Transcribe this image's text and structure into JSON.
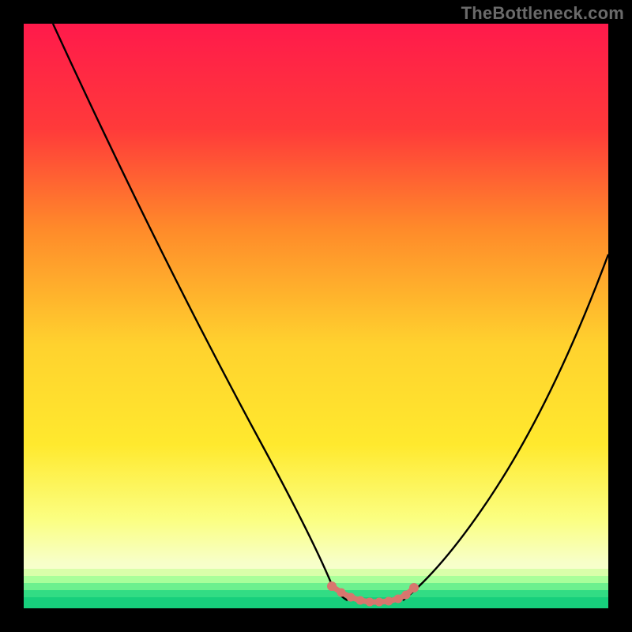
{
  "watermark": "TheBottleneck.com",
  "chart_data": {
    "type": "line",
    "title": "",
    "xlabel": "",
    "ylabel": "",
    "xlim": [
      0,
      100
    ],
    "ylim": [
      0,
      100
    ],
    "grid": false,
    "legend": false,
    "series": [
      {
        "name": "left-curve",
        "x": [
          5,
          10,
          15,
          20,
          25,
          30,
          35,
          40,
          45,
          48,
          50,
          52,
          54
        ],
        "values": [
          100,
          88,
          76,
          65,
          54,
          44,
          34,
          24,
          14,
          8,
          4,
          2,
          1
        ]
      },
      {
        "name": "right-curve",
        "x": [
          64,
          66,
          68,
          70,
          73,
          76,
          80,
          84,
          88,
          92,
          96,
          100
        ],
        "values": [
          1,
          2,
          4,
          6,
          10,
          15,
          22,
          30,
          38,
          46,
          54,
          61
        ]
      },
      {
        "name": "flat-bottom-marker",
        "x": [
          52,
          53,
          54,
          55,
          56,
          57,
          58,
          59,
          60,
          61,
          62,
          63,
          64,
          65,
          66
        ],
        "values": [
          1.5,
          1,
          0.8,
          0.7,
          0.6,
          0.6,
          0.6,
          0.6,
          0.6,
          0.6,
          0.7,
          0.8,
          1,
          1.2,
          1.5
        ]
      }
    ],
    "background_gradient": {
      "top": "#ff1a4b",
      "mid1": "#ff8a2a",
      "mid2": "#ffe92e",
      "mid3": "#f7ffb7",
      "bottom_stripes": [
        "#d9ffaa",
        "#a8ff9a",
        "#6cf08e",
        "#32dc84",
        "#17cf7c"
      ]
    },
    "plot_border": "#000000",
    "marker_color": "#d8766e",
    "curve_color": "#000000"
  }
}
